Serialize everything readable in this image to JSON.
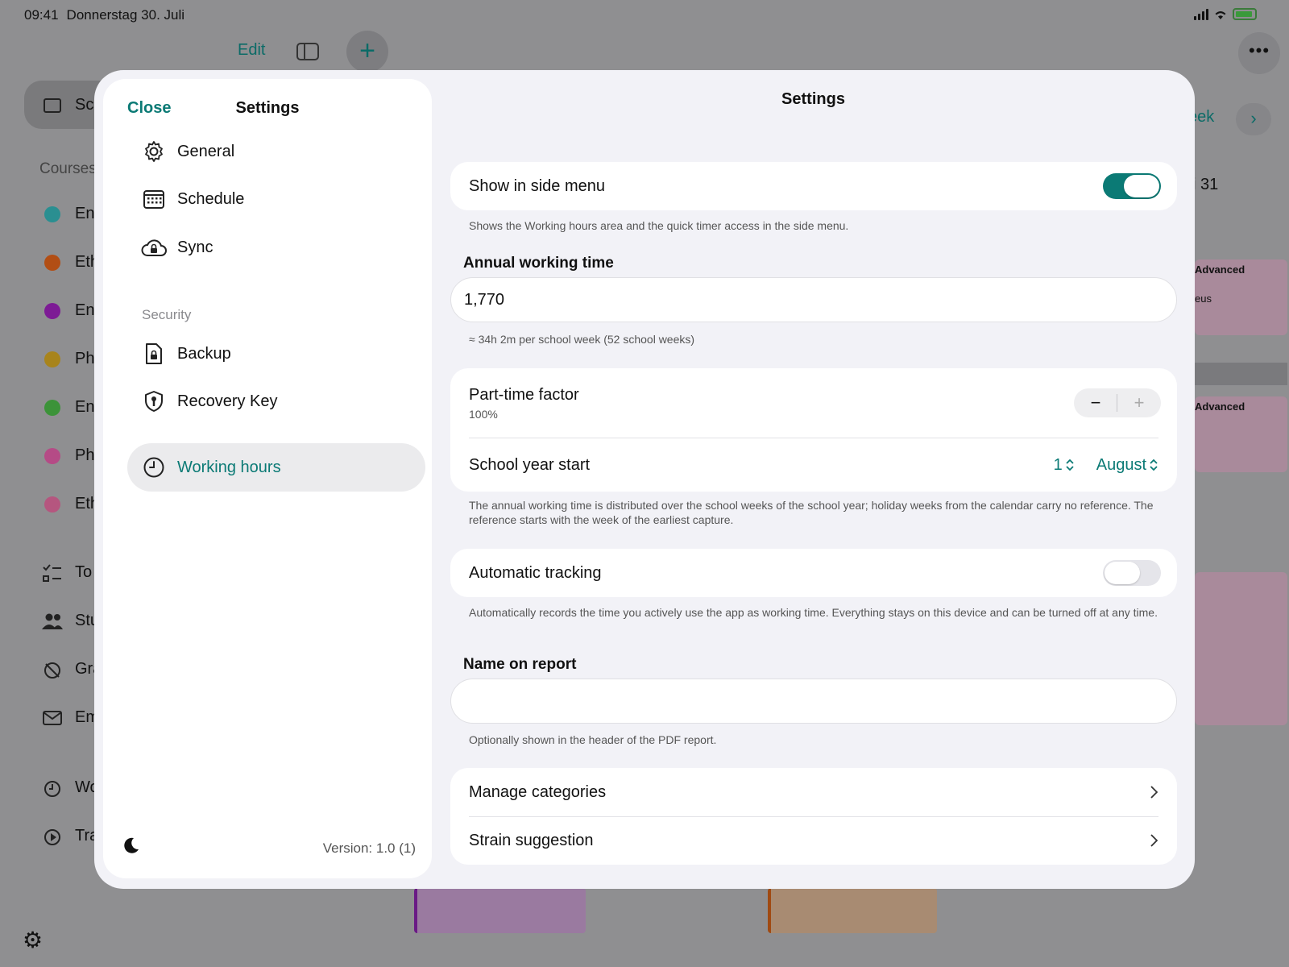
{
  "status_bar": {
    "time": "09:41",
    "date": "Donnerstag 30. Juli"
  },
  "background": {
    "edit_label": "Edit",
    "add_symbol": "+",
    "more_symbol": "•••",
    "schedule_short": "Sc",
    "courses_short": "Courses",
    "courses": [
      {
        "label": "En",
        "color": "#2a8f91"
      },
      {
        "label": "Eth",
        "color": "#b24e14"
      },
      {
        "label": "En",
        "color": "#7d1b95"
      },
      {
        "label": "Ph",
        "color": "#a8841c"
      },
      {
        "label": "En",
        "color": "#3c9339"
      },
      {
        "label": "Ph",
        "color": "#b54b86"
      },
      {
        "label": "Eth",
        "color": "#b5567f"
      }
    ],
    "tools": [
      {
        "label": "To",
        "icon": "checklist-icon"
      },
      {
        "label": "Stu",
        "icon": "people-icon"
      },
      {
        "label": "Gra",
        "icon": "grade-icon"
      },
      {
        "label": "Em",
        "icon": "mail-icon"
      },
      {
        "label": "Wo",
        "icon": "clock-icon"
      },
      {
        "label": "Tra",
        "icon": "play-icon"
      }
    ],
    "week_label": "eek",
    "next_symbol": "›",
    "day_label": "i 31",
    "card1_title": "Advanced",
    "card1_sub": "eus",
    "card2_title": "Advanced"
  },
  "sidebar": {
    "close_label": "Close",
    "title": "Settings",
    "items": [
      {
        "label": "General",
        "icon": "gear-icon"
      },
      {
        "label": "Schedule",
        "icon": "calendar-icon"
      },
      {
        "label": "Sync",
        "icon": "cloud-lock-icon"
      }
    ],
    "security_label": "Security",
    "security_items": [
      {
        "label": "Backup",
        "icon": "document-lock-icon"
      },
      {
        "label": "Recovery Key",
        "icon": "key-shield-icon"
      }
    ],
    "active_item": {
      "label": "Working hours",
      "icon": "clock-icon"
    },
    "version": "Version: 1.0 (1)"
  },
  "main": {
    "title": "Settings",
    "show_in_side_menu": {
      "label": "Show in side menu",
      "enabled": true,
      "note": "Shows the Working hours area and the quick timer access in the side menu."
    },
    "annual_working_time": {
      "heading": "Annual working time",
      "value": "1,770",
      "note": "≈ 34h 2m per school week (52 school weeks)"
    },
    "part_time": {
      "label": "Part-time factor",
      "value": "100%",
      "minus": "−",
      "plus": "+"
    },
    "school_year_start": {
      "label": "School year start",
      "day": "1",
      "month": "August"
    },
    "distribution_note": "The annual working time is distributed over the school weeks of the school year; holiday weeks from the calendar carry no reference. The reference starts with the week of the earliest capture.",
    "automatic_tracking": {
      "label": "Automatic tracking",
      "enabled": false,
      "note": "Automatically records the time you actively use the app as working time. Everything stays on this device and can be turned off at any time."
    },
    "name_on_report": {
      "heading": "Name on report",
      "value": "",
      "note": "Optionally shown in the header of the PDF report."
    },
    "links": [
      {
        "label": "Manage categories"
      },
      {
        "label": "Strain suggestion"
      }
    ]
  },
  "colors": {
    "accent": "#0b7a75",
    "modal_background": "#f2f2f7",
    "toggle_off": "#e5e5ea"
  }
}
